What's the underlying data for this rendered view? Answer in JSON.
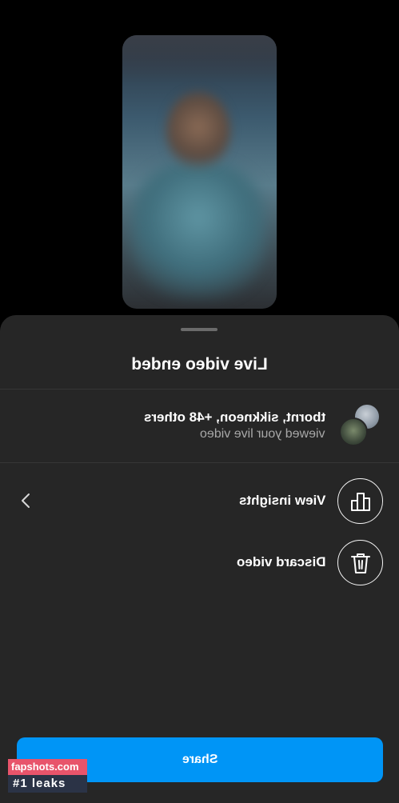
{
  "sheet": {
    "title": "Live video ended",
    "viewers": {
      "names": "tbornt, sikkneon, +48 others",
      "subtitle": "viewed your live video"
    },
    "actions": [
      {
        "label": "View insights",
        "icon": "bar-chart-icon"
      },
      {
        "label": "Discard video",
        "icon": "trash-icon"
      }
    ],
    "share_label": "Share"
  },
  "watermark": {
    "line1": "fapshots.com",
    "line2": "#1 leaks"
  },
  "colors": {
    "sheet_bg": "#262626",
    "share_button": "#0095f6",
    "secondary_text": "#a8a8a8"
  }
}
